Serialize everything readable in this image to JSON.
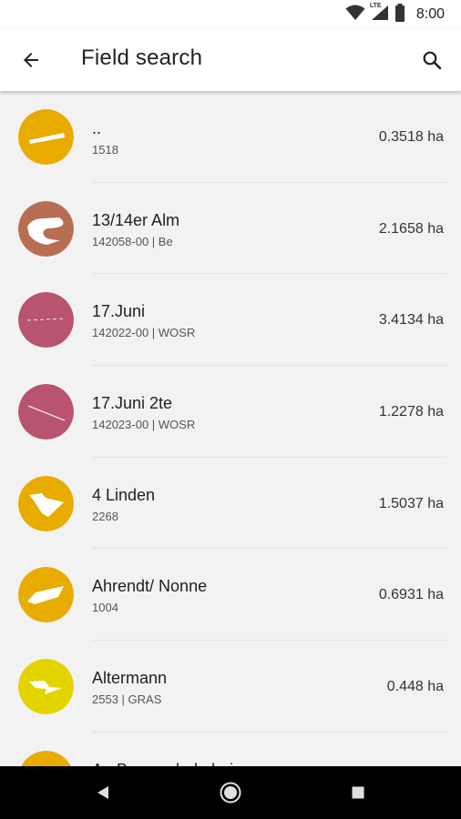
{
  "status_bar": {
    "time": "8:00",
    "network": "LTE",
    "icons": [
      "wifi-icon",
      "signal-icon",
      "battery-icon"
    ]
  },
  "app_bar": {
    "title": "Field search",
    "back_icon": "arrow-left-icon",
    "search_icon": "search-icon"
  },
  "fields": [
    {
      "name": "..",
      "subtitle": "1518",
      "area": "0.3518 ha",
      "color": "#e8ac00",
      "shape_icon": "field-shape-icon"
    },
    {
      "name": "13/14er Alm",
      "subtitle": "142058-00 | Be",
      "area": "2.1658 ha",
      "color": "#b86e52",
      "shape_icon": "field-shape-icon"
    },
    {
      "name": "17.Juni",
      "subtitle": "142022-00 | WOSR",
      "area": "3.4134 ha",
      "color": "#b85370",
      "shape_icon": "field-shape-icon"
    },
    {
      "name": "17.Juni 2te",
      "subtitle": "142023-00 | WOSR",
      "area": "1.2278 ha",
      "color": "#b85370",
      "shape_icon": "field-shape-icon"
    },
    {
      "name": "4 Linden",
      "subtitle": "2268",
      "area": "1.5037 ha",
      "color": "#e8ac00",
      "shape_icon": "field-shape-icon"
    },
    {
      "name": "Ahrendt/ Nonne",
      "subtitle": "1004",
      "area": "0.6931 ha",
      "color": "#e8ac00",
      "shape_icon": "field-shape-icon"
    },
    {
      "name": "Altermann",
      "subtitle": "2553 | GRAS",
      "area": "0.448 ha",
      "color": "#e3d400",
      "shape_icon": "field-shape-icon"
    },
    {
      "name": "An Baumschule hei",
      "subtitle": "",
      "area": "",
      "color": "#e8ac00",
      "shape_icon": "field-shape-icon"
    }
  ],
  "nav_bar": {
    "icons": [
      "back-triangle-icon",
      "home-circle-icon",
      "recents-square-icon"
    ]
  }
}
